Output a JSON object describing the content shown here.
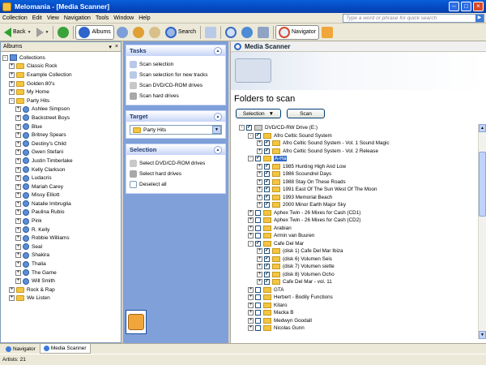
{
  "window": {
    "title": "Melomania - [Media Scanner]"
  },
  "menu": {
    "items": [
      "Collection",
      "Edit",
      "View",
      "Navigation",
      "Tools",
      "Window",
      "Help"
    ],
    "search_placeholder": "Type a word or phrase for quick search"
  },
  "toolbar": {
    "back": "Back",
    "albums": "Albums",
    "search": "Search",
    "navigator": "Navigator"
  },
  "albums_panel": {
    "title": "Albums",
    "root": "Collections",
    "top_items": [
      "Classic Rock",
      "Example Collection",
      "Golden 80's",
      "My Home"
    ],
    "open_folder": "Party Hits",
    "artists": [
      "Ashlee Simpson",
      "Backstreet Boys",
      "Blue",
      "Britney Spears",
      "Destiny's Child",
      "Gwen Stefani",
      "Justin Timberlake",
      "Kelly Clarkson",
      "Ludacris",
      "Mariah Carey",
      "Missy Elliott",
      "Natalie Imbruglia",
      "Paulina Rubio",
      "Pink",
      "R. Kelly",
      "Robbie Williams",
      "Seal",
      "Shakira",
      "Thalia",
      "The Game",
      "Will Smith"
    ],
    "bottom_items": [
      "Rock & Rap",
      "We Listen"
    ]
  },
  "tasks": {
    "tasks_title": "Tasks",
    "tasks_links": [
      "Scan selection",
      "Scan selection for new tracks",
      "Scan DVD/CD-ROM drives",
      "Scan hard drives"
    ],
    "target_title": "Target",
    "target_value": "Party Hits",
    "selection_title": "Selection",
    "selection_links": [
      "Select DVD/CD-ROM drives",
      "Select hard drives",
      "Deselect all"
    ]
  },
  "scanner": {
    "header": "Media Scanner",
    "title": "Folders to scan",
    "selection_button": "Selection",
    "scan_button": "Scan",
    "tree": [
      {
        "level": 0,
        "exp": "-",
        "check": "✓",
        "icon": "drive",
        "label": "DVD/CD-RW Drive (E:)"
      },
      {
        "level": 1,
        "exp": "-",
        "check": "✓",
        "icon": "folder",
        "label": "Afro Celtic Sound System"
      },
      {
        "level": 2,
        "exp": "+",
        "check": "✓",
        "icon": "folder",
        "label": "Afro Celtic Sound System - Vol. 1 Sound Magic"
      },
      {
        "level": 2,
        "exp": "+",
        "check": "✓",
        "icon": "folder",
        "label": "Afro Celtic Sound System - Vol. 2 Release"
      },
      {
        "level": 1,
        "exp": "-",
        "check": "✓",
        "icon": "folder",
        "label": "A-Ha",
        "highlight": true
      },
      {
        "level": 2,
        "exp": "+",
        "check": "✓",
        "icon": "folder",
        "label": "1985 Hunting High And Low"
      },
      {
        "level": 2,
        "exp": "+",
        "check": "✓",
        "icon": "folder",
        "label": "1986 Scoundrel Days"
      },
      {
        "level": 2,
        "exp": "+",
        "check": "✓",
        "icon": "folder",
        "label": "1988 Stay On These Roads"
      },
      {
        "level": 2,
        "exp": "+",
        "check": "✓",
        "icon": "folder",
        "label": "1991 East Of The Sun West Of The Moon"
      },
      {
        "level": 2,
        "exp": "+",
        "check": "✓",
        "icon": "folder",
        "label": "1993 Memorial Beach"
      },
      {
        "level": 2,
        "exp": "+",
        "check": "✓",
        "icon": "folder",
        "label": "2000 Minor Earth Major Sky"
      },
      {
        "level": 1,
        "exp": "+",
        "check": "",
        "icon": "folder",
        "label": "Aphex Twin - 26 Mixes for Cash (CD1)"
      },
      {
        "level": 1,
        "exp": "+",
        "check": "",
        "icon": "folder",
        "label": "Aphex Twin - 26 Mixes for Cash (CD2)"
      },
      {
        "level": 1,
        "exp": "+",
        "check": "",
        "icon": "folder",
        "label": "Arabian"
      },
      {
        "level": 1,
        "exp": "+",
        "check": "",
        "icon": "folder",
        "label": "Armin van Buuren"
      },
      {
        "level": 1,
        "exp": "-",
        "check": "✓",
        "icon": "folder",
        "label": "Cafe Del Mar"
      },
      {
        "level": 2,
        "exp": "+",
        "check": "✓",
        "icon": "folder",
        "label": "(disk 1) Cafe Del Mar Ibiza"
      },
      {
        "level": 2,
        "exp": "+",
        "check": "✓",
        "icon": "folder",
        "label": "(disk 6) Volumen Seis"
      },
      {
        "level": 2,
        "exp": "+",
        "check": "✓",
        "icon": "folder",
        "label": "(disk 7) Volumen siette"
      },
      {
        "level": 2,
        "exp": "+",
        "check": "✓",
        "icon": "folder",
        "label": "(disk 8) Volumen Ocho"
      },
      {
        "level": 2,
        "exp": "+",
        "check": "✓",
        "icon": "folder",
        "label": "Cafe Del Mar - vol. 11"
      },
      {
        "level": 1,
        "exp": "+",
        "check": "",
        "icon": "folder",
        "label": "GTA"
      },
      {
        "level": 1,
        "exp": "+",
        "check": "",
        "icon": "folder",
        "label": "Herbert - Bodily Functions"
      },
      {
        "level": 1,
        "exp": "+",
        "check": "",
        "icon": "folder",
        "label": "Kitaro"
      },
      {
        "level": 1,
        "exp": "+",
        "check": "",
        "icon": "folder",
        "label": "Macka B"
      },
      {
        "level": 1,
        "exp": "+",
        "check": "",
        "icon": "folder",
        "label": "Medwyn Goodall"
      },
      {
        "level": 1,
        "exp": "+",
        "check": "",
        "icon": "folder",
        "label": "Nicolas Gunn"
      }
    ]
  },
  "bottom_tabs": [
    "Navigator",
    "Media Scanner"
  ],
  "status": {
    "text": "Artists: 21"
  },
  "colors": {
    "title_bar": "#0349c2",
    "task_pane": "#7fa0d9",
    "highlight": "#316ac5"
  }
}
